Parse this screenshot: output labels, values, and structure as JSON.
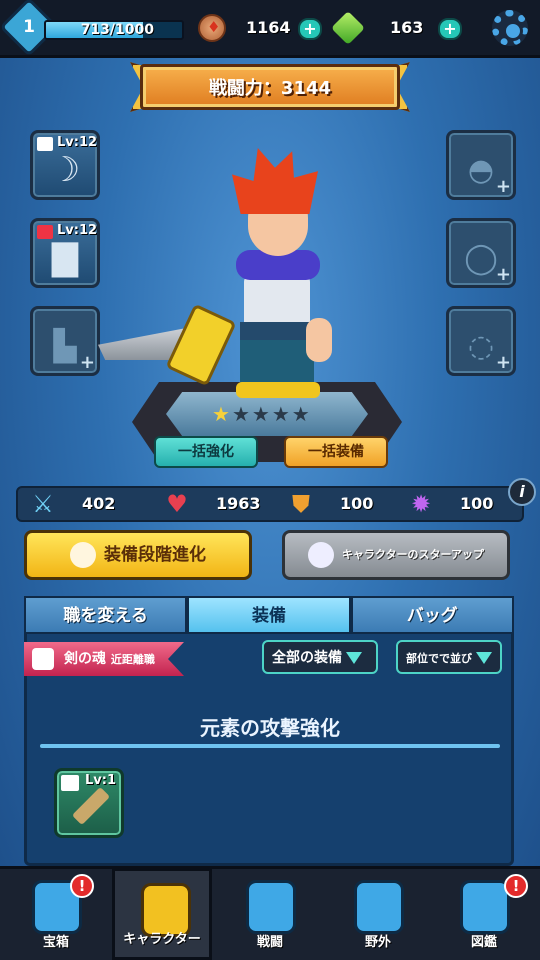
{
  "header": {
    "level": "1",
    "xp_text": "713/1000",
    "xp_progress": 0.713,
    "coins": "1164",
    "gems": "163"
  },
  "power": {
    "label": "戦闘力：3144"
  },
  "equipment": {
    "weapon": {
      "level": "Lv:12",
      "icon": "scimitar-icon"
    },
    "armor": {
      "level": "Lv:12",
      "icon": "armor-icon"
    },
    "boots": {
      "icon": "boot-icon"
    },
    "helmet": {
      "icon": "helmet-icon"
    },
    "necklace": {
      "icon": "necklace-icon"
    },
    "ring": {
      "icon": "ring-icon"
    }
  },
  "character": {
    "stars_filled": 1,
    "stars_total": 5
  },
  "actions": {
    "bulk_upgrade": "一括強化",
    "bulk_equip": "一括装備",
    "evolve": "装備段階進化",
    "star_up": "キャラクターのスターアップ"
  },
  "stats": {
    "attack": "402",
    "hp": "1963",
    "defense": "100",
    "magic": "100",
    "info": "i"
  },
  "tabs": [
    "職を変える",
    "装備",
    "バッグ"
  ],
  "active_tab": 1,
  "category": {
    "name": "剣の魂",
    "sub": "近距離職"
  },
  "filters": {
    "all_equipment": "全部の装備",
    "sort": "部位でで並び"
  },
  "section_title": "元素の攻撃強化",
  "items": [
    {
      "level": "Lv:1",
      "icon": "dagger-icon"
    }
  ],
  "nav": [
    {
      "label": "宝箱",
      "badge": "!"
    },
    {
      "label": "キャラクター"
    },
    {
      "label": "戦闘"
    },
    {
      "label": "野外"
    },
    {
      "label": "図鑑",
      "badge": "!"
    }
  ],
  "colors": {
    "accent_teal": "#26b0ae",
    "accent_orange": "#f0a227",
    "accent_yellow": "#f2b515",
    "background": "#2e6fb0"
  }
}
